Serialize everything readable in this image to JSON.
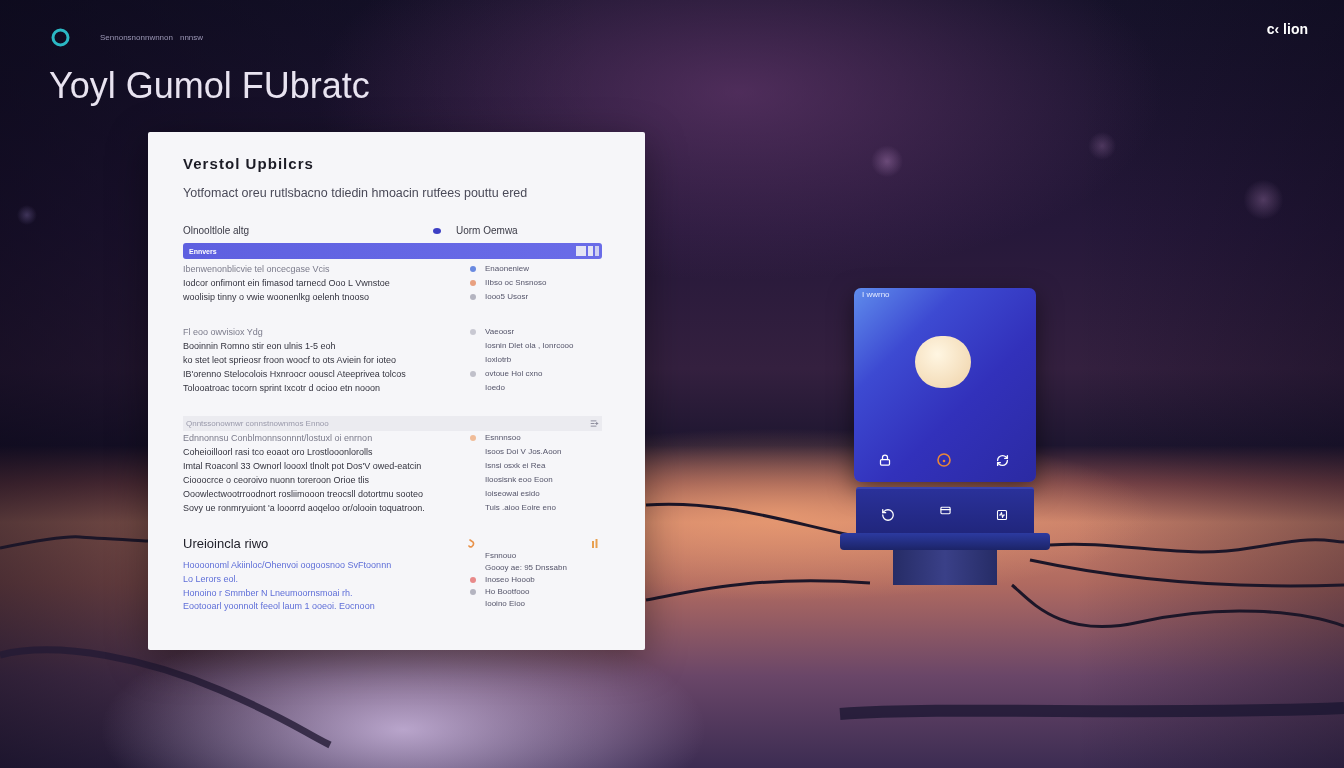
{
  "header": {
    "nav": [
      "Sennonsnonnwnnon",
      "nnnsw"
    ],
    "corner_text": "c‹ lion"
  },
  "hero_title": "Yoyl Gumol FUbratc",
  "card": {
    "title": "Verstol Upbilcrs",
    "subtitle": "Yotfomact oreu rutlsbacno tdiedin hmoacin rutfees pouttu ered",
    "filter": {
      "label": "Olnooltlole altg",
      "value": "Uorm Oemwa"
    },
    "bar": {
      "label": "Ennvers"
    },
    "sections": [
      {
        "kind": "list",
        "caption": "Ibenwenonblicvie tel oncecgase Vcis",
        "lines": [
          "Iodcor onfimont ein fimasod tarnecd Ooo L Vwnstoe",
          "woolisip tinny o vwie woonenlkg oelenh tnooso"
        ],
        "side": [
          {
            "text": "Enaoneniew",
            "color": "#6a8ae0"
          },
          {
            "text": "IIbso oc Snsnoso",
            "color": "#e8a080"
          },
          {
            "text": "Iooo5 Usosr",
            "color": "#b4b4c0"
          }
        ]
      },
      {
        "kind": "list",
        "caption": "Fl eoo owvisiox Ydg",
        "lines": [
          "Booinnin Romno stir eon ulnis 1-5 eoh",
          "ko stet leot sprieosr froon woocf to ots Aviein for ioteo",
          "IB'orenno Stelocolois Hxnroocr oouscl Ateeprivea tolcos",
          "Tolooatroac tocorn sprint Ixcotr d ocioo etn nooon"
        ],
        "side": [
          {
            "text": "Vaeoosr",
            "color": "#c8c8d2"
          },
          {
            "text": "Iosnin Dlet ola , Ionrcooo"
          },
          {
            "text": "Ioxlotrb"
          },
          {
            "text": "ovtoue Hol cxno",
            "color": "#c0c0ca"
          },
          {
            "text": "Ioedo"
          }
        ]
      },
      {
        "kind": "list",
        "band": "Qnntssonownwr connstnownmos Ennoo",
        "caption": "Ednnonnsu Conblmonnsonnnt/lostuxl oi enrnon",
        "lines": [
          "Coheioilloorl rasi tco eoaot oro Lrostlooonlorolls",
          "Imtal Roaconl 33 Ownorl loooxl tlnolt pot Dos'V owed-eatcin",
          "Ciooocrce o ceoroivo nuonn toreroon Orioe tlis",
          "Ooowlectwootrroodnort rosliimooon treocsll dotortmu sooteo",
          "Sovy ue ronmryuiont 'a looorrd aoqeloo or/olooin toquatroon."
        ],
        "side": [
          {
            "text": "Esnnnsoo",
            "color": "#f0bc98"
          },
          {
            "text": "Isoos Doi V Jos.Aoon"
          },
          {
            "text": "Isnsi osxk ei Rea"
          },
          {
            "text": "Iloosisnk eoo Eoon"
          },
          {
            "text": "Ioiseowai esido"
          },
          {
            "text": "Tuis .aioo Eoire eno"
          }
        ]
      },
      {
        "kind": "links",
        "heading": "Ureioincla riwo",
        "lines": [
          "Hoooonoml Akiinloc/Ohenvoi oogoosnoo SvFtoonnn",
          "Lo Lerors eol.",
          "Honoino r Smmber N Lneumoornsmoai rh.",
          "Eootooarl yoonnolt feeol laum 1 ooeoi. Eocnoon"
        ],
        "side": [
          {
            "text": "Fsnnouo"
          },
          {
            "text": "Goooy ae: 95 Dnssabn"
          },
          {
            "text": "Inoseo Hooob",
            "color": "#e88a8a"
          },
          {
            "text": "Ho Bootfooo",
            "color": "#b4b4c0"
          },
          {
            "text": "Iooino Eioo"
          }
        ]
      }
    ]
  },
  "device": {
    "label": "I wwrno"
  }
}
